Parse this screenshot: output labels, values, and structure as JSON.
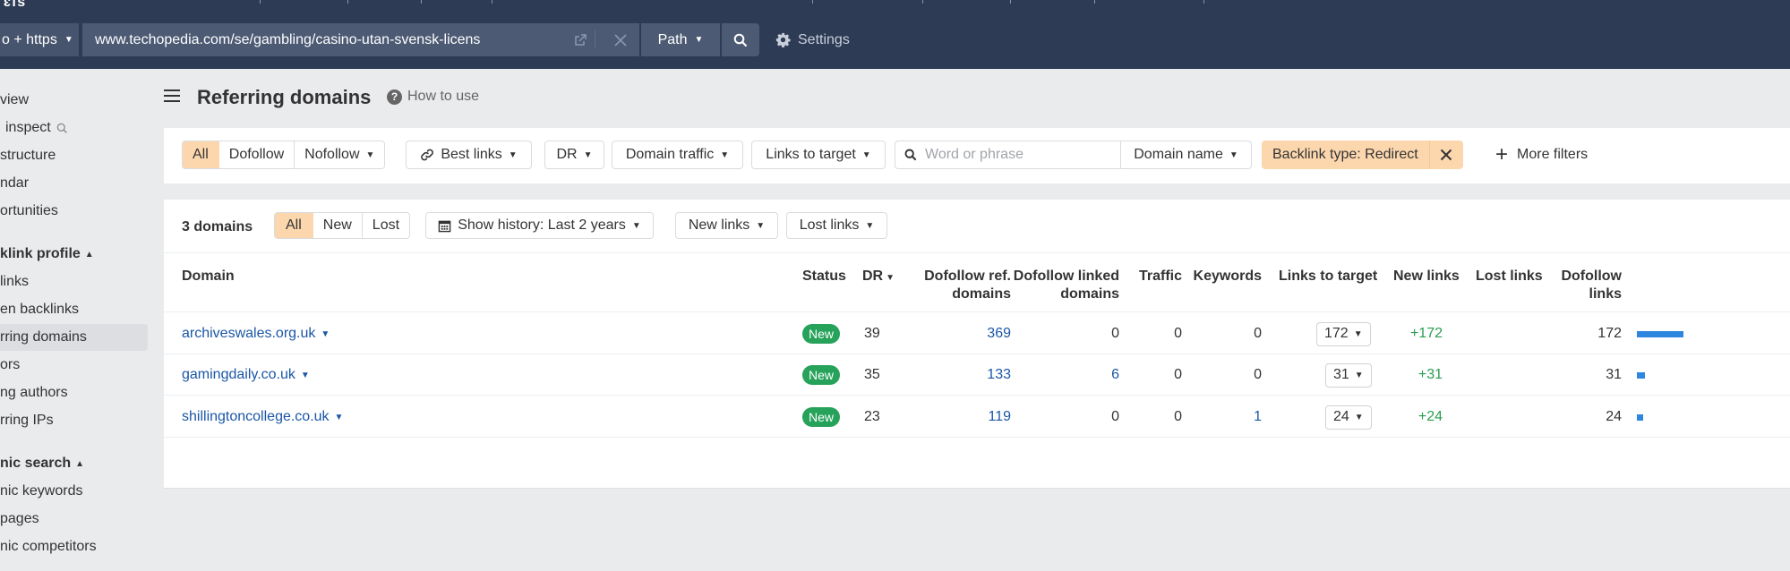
{
  "topbar": {
    "logo_fragment": "ɛfs",
    "protocol_label": "o + https",
    "url_value": "www.techopedia.com/se/gambling/casino-utan-svensk-licens",
    "mode_label": "Path",
    "settings_label": "Settings"
  },
  "sidebar": {
    "items": [
      {
        "label": "view"
      },
      {
        "label": "inspect"
      },
      {
        "label": "structure"
      },
      {
        "label": "ndar"
      },
      {
        "label": "ortunities"
      }
    ],
    "sections": [
      {
        "title": "klink profile",
        "items": [
          {
            "label": "links"
          },
          {
            "label": "en backlinks"
          },
          {
            "label": "rring domains",
            "active": true
          },
          {
            "label": "ors"
          },
          {
            "label": "ng authors"
          },
          {
            "label": "rring IPs"
          }
        ]
      },
      {
        "title": "nic search",
        "items": [
          {
            "label": "nic keywords"
          },
          {
            "label": "pages"
          },
          {
            "label": "nic competitors"
          }
        ]
      }
    ]
  },
  "header": {
    "title": "Referring domains",
    "how_to_use": "How to use"
  },
  "filters": {
    "link_type": [
      "All",
      "Dofollow",
      "Nofollow"
    ],
    "link_type_selected": "All",
    "best_links": "Best links",
    "dr": "DR",
    "domain_traffic": "Domain traffic",
    "links_to_target": "Links to target",
    "search_placeholder": "Word or phrase",
    "search_value": "",
    "search_scope": "Domain name",
    "active_filter": "Backlink type: Redirect",
    "more_filters": "More filters"
  },
  "table": {
    "count_label": "3 domains",
    "status_tabs": [
      "All",
      "New",
      "Lost"
    ],
    "status_selected": "All",
    "history": "Show history: Last 2 years",
    "new_links": "New links",
    "lost_links": "Lost links",
    "columns": {
      "domain": "Domain",
      "status": "Status",
      "dr": "DR",
      "dofollow_ref_1": "Dofollow ref.",
      "dofollow_ref_2": "domains",
      "dofollow_linked_1": "Dofollow linked",
      "dofollow_linked_2": "domains",
      "traffic": "Traffic",
      "keywords": "Keywords",
      "links_to_target": "Links to target",
      "new_links": "New links",
      "lost_links": "Lost links",
      "dofollow_links_1": "Dofollow",
      "dofollow_links_2": "links"
    },
    "rows": [
      {
        "domain": "archiveswales.org.uk",
        "status": "New",
        "dr": "39",
        "dofollow_ref_domains": "369",
        "dofollow_linked_domains": "0",
        "traffic": "0",
        "keywords": "0",
        "links_to_target": "172",
        "new_links": "+172",
        "lost_links": "",
        "dofollow_links": "172",
        "dofollow_share": 1.0
      },
      {
        "domain": "gamingdaily.co.uk",
        "status": "New",
        "dr": "35",
        "dofollow_ref_domains": "133",
        "dofollow_linked_domains": "6",
        "traffic": "0",
        "keywords": "0",
        "links_to_target": "31",
        "new_links": "+31",
        "lost_links": "",
        "dofollow_links": "31",
        "dofollow_share": 0.18
      },
      {
        "domain": "shillingtoncollege.co.uk",
        "status": "New",
        "dr": "23",
        "dofollow_ref_domains": "119",
        "dofollow_linked_domains": "0",
        "traffic": "0",
        "keywords": "1",
        "links_to_target": "24",
        "new_links": "+24",
        "lost_links": "",
        "dofollow_links": "24",
        "dofollow_share": 0.14
      }
    ]
  },
  "colors": {
    "topbar": "#2e3b55",
    "accent_selected": "#fcd7ae",
    "link": "#1a56a6",
    "positive": "#2a9d4f",
    "badge_new": "#27a25a",
    "bar": "#2e86de"
  }
}
